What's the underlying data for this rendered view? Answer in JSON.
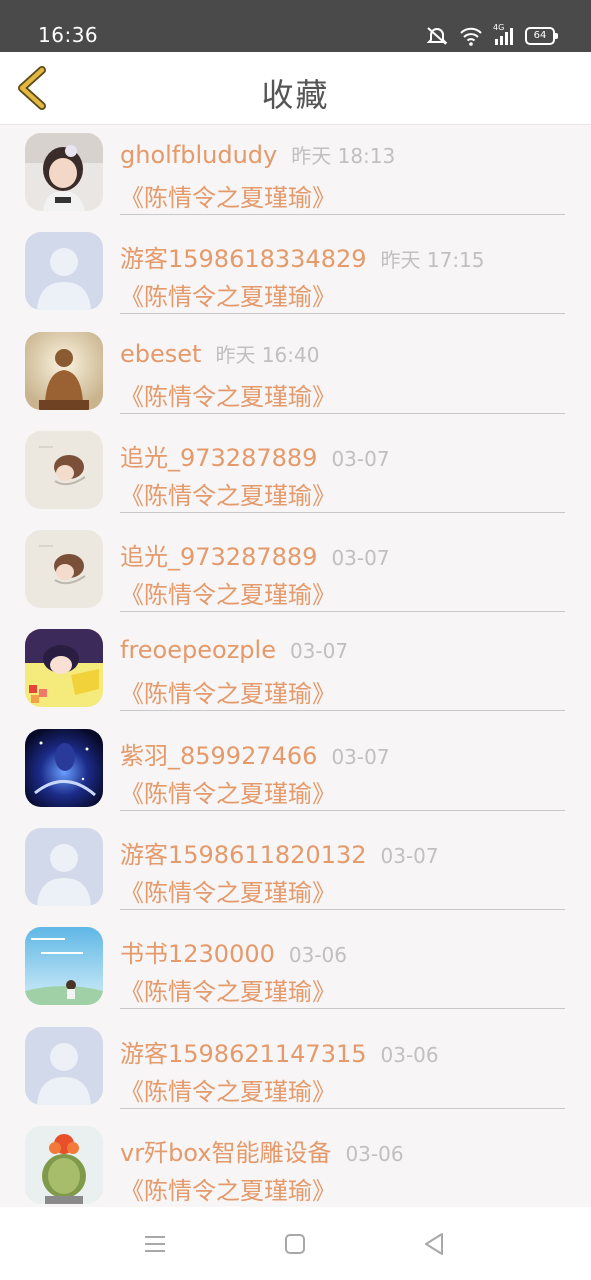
{
  "status_bar": {
    "time": "16:36",
    "battery": "64",
    "network": "4G"
  },
  "header": {
    "title": "收藏",
    "back_icon": "chevron-left-icon"
  },
  "colors": {
    "accent": "#e49a6a",
    "muted": "#c0c0c0",
    "back_icon": "#e2b843"
  },
  "list": [
    {
      "username": "gholfblududy",
      "time": "昨天 18:13",
      "book": "《陈情令之夏瑾瑜》",
      "avatar": "child-photo"
    },
    {
      "username": "游客1598618334829",
      "time": "昨天 17:15",
      "book": "《陈情令之夏瑾瑜》",
      "avatar": "default-avatar"
    },
    {
      "username": "ebeset",
      "time": "昨天 16:40",
      "book": "《陈情令之夏瑾瑜》",
      "avatar": "buddha"
    },
    {
      "username": "追光_973287889",
      "time": "03-07",
      "book": "《陈情令之夏瑾瑜》",
      "avatar": "girl-sketch"
    },
    {
      "username": "追光_973287889",
      "time": "03-07",
      "book": "《陈情令之夏瑾瑜》",
      "avatar": "girl-sketch"
    },
    {
      "username": "freoepeozple",
      "time": "03-07",
      "book": "《陈情令之夏瑾瑜》",
      "avatar": "anime-pink-yellow"
    },
    {
      "username": "紫羽_859927466",
      "time": "03-07",
      "book": "《陈情令之夏瑾瑜》",
      "avatar": "galaxy"
    },
    {
      "username": "游客1598611820132",
      "time": "03-07",
      "book": "《陈情令之夏瑾瑜》",
      "avatar": "default-avatar"
    },
    {
      "username": "书书1230000",
      "time": "03-06",
      "book": "《陈情令之夏瑾瑜》",
      "avatar": "sky-girl"
    },
    {
      "username": "游客1598621147315",
      "time": "03-06",
      "book": "《陈情令之夏瑾瑜》",
      "avatar": "default-avatar"
    },
    {
      "username": "vr歼box智能雕设备",
      "time": "03-06",
      "book": "《陈情令之夏瑾瑜》",
      "avatar": "cactus"
    }
  ],
  "nav": {
    "menu_icon": "menu-icon",
    "home_icon": "home-square-icon",
    "back_icon": "triangle-back-icon"
  }
}
